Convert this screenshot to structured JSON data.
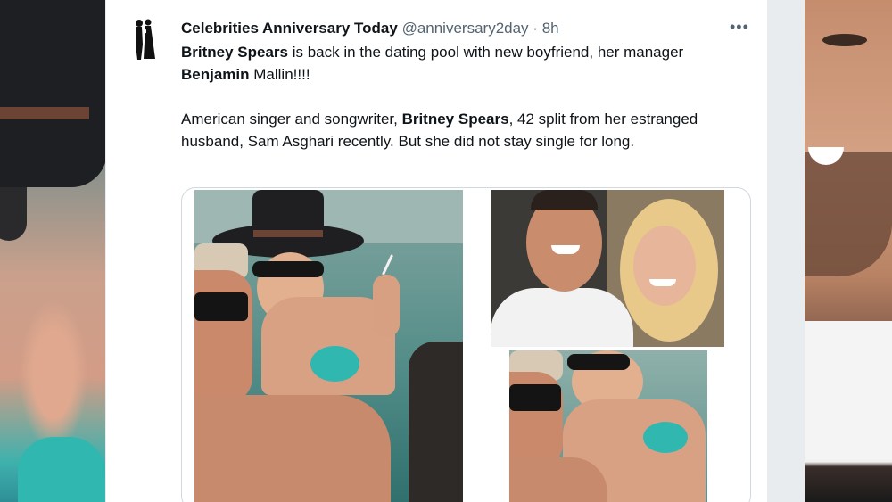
{
  "tweet": {
    "display_name": "Celebrities Anniversary Today",
    "handle": "@anniversary2day",
    "separator": "·",
    "time": "8h",
    "more_label": "•••",
    "p1": {
      "bold1": "Britney Spears",
      "t1": " is back in the dating pool with new boyfriend, her manager ",
      "bold2": "Benjamin",
      "t2": " Mallin!!!!"
    },
    "p2": {
      "t1": "American singer and songwriter, ",
      "bold1": "Britney Spears",
      "t2": ", 42 split from her estranged husband, Sam Asghari recently. But she did not stay single for long."
    }
  },
  "colors": {
    "text": "#0f1419",
    "muted": "#536471",
    "border": "#cfd9de",
    "pool": "#4f8a86",
    "bikini": "#2fb7b0"
  },
  "icons": {
    "avatar": "wedding-couple-silhouette-icon",
    "more": "more-options-icon"
  }
}
